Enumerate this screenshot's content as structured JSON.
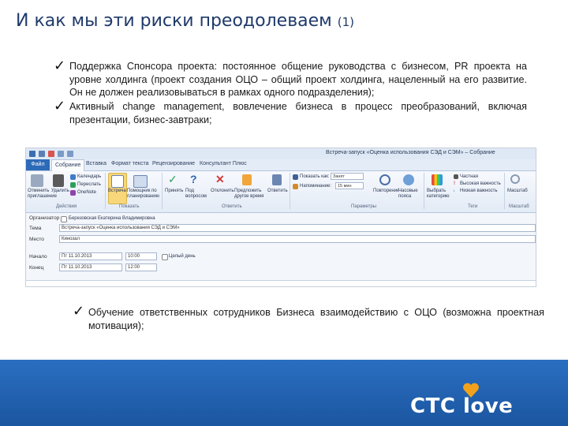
{
  "slide": {
    "title": "И как мы эти риски преодолеваем",
    "title_suffix": "(1)",
    "bullets": [
      "Поддержка Спонсора проекта: постоянное общение руководства с бизнесом, PR проекта на уровне холдинга (проект создания ОЦО – общий проект холдинга, нацеленный на его развитие. Он не должен реализовываться в рамках одного подразделения);",
      "Активный change management, вовлечение бизнеса в процесс преобразований, включая презентации, бизнес-завтраки;",
      "Обучение ответственных сотрудников Бизнеса взаимодействию с ОЦО (возможна проектная мотивация);"
    ],
    "check_glyph": "✓"
  },
  "screenshot": {
    "window_title": "Встреча-запуск «Оценка использования СЭД и СЭМ» – Собрание",
    "tabs": [
      "Файл",
      "Собрание",
      "Вставка",
      "Формат текста",
      "Рецензирование",
      "Консультант Плюс"
    ],
    "ribbon": {
      "actions": [
        "Отменить приглашение",
        "Удалить",
        "Календарь",
        "Переслать",
        "OneNote",
        "Встреча",
        "Помощник по планированию",
        "Принять",
        "Под вопросом",
        "Отклонить",
        "Предложить другое время",
        "Ответить",
        "Показать как:",
        "Занят",
        "Напоминание:",
        "15 мин",
        "Повторение",
        "Часовые пояса",
        "Выбрать категорию",
        "Частная",
        "Высокая важность",
        "Низкая важность",
        "Масштаб"
      ],
      "groups": [
        "Действия",
        "Показать",
        "Ответить",
        "Параметры",
        "Теги",
        "Масштаб"
      ]
    },
    "form": {
      "organizer_label": "Организатор",
      "organizer_value": "Березовская Екатерина Владимировна",
      "subject_label": "Тема",
      "subject_value": "Встреча-запуск «Оценка использования СЭД и СЭМ»",
      "location_label": "Место",
      "location_value": "Кинозал",
      "start_label": "Начало",
      "start_date": "Пт 11.10.2013",
      "start_time": "10:00",
      "allday_label": "Целый день",
      "end_label": "Конец",
      "end_date": "Пт 11.10.2013",
      "end_time": "12:00"
    }
  },
  "footer": {
    "logo_text": "СТС love"
  },
  "colors": {
    "title": "#1f3a6b",
    "footer": "#1f5fae",
    "logo_heart": "#f2a21a"
  }
}
